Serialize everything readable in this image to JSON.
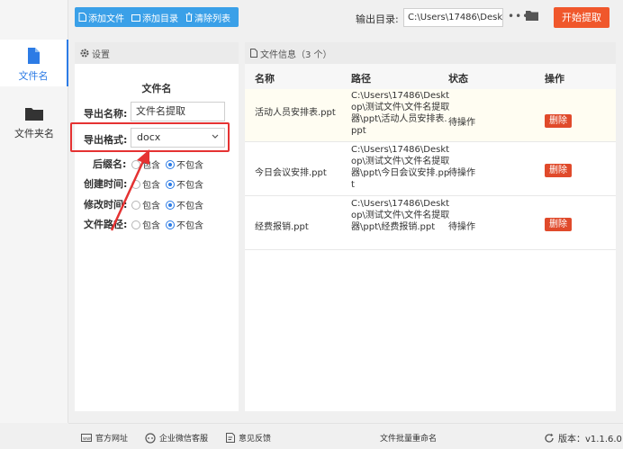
{
  "nav": {
    "items": [
      {
        "label": "文件名",
        "icon": "file-icon",
        "active": true
      },
      {
        "label": "文件夹名",
        "icon": "folder-icon",
        "active": false
      }
    ]
  },
  "toolbar": {
    "add_file": "添加文件",
    "add_dir": "添加目录",
    "clear_list": "清除列表",
    "output_label": "输出目录:",
    "output_path": "C:\\Users\\17486\\Deskto",
    "more": "•••",
    "start": "开始提取"
  },
  "settings": {
    "header": "设置",
    "section_title": "文件名",
    "export_name_label": "导出名称:",
    "export_name_value": "文件名提取",
    "export_format_label": "导出格式:",
    "export_format_value": "docx",
    "options": [
      {
        "label": "后缀名:",
        "include": "包含",
        "exclude": "不包含",
        "selected": "exclude"
      },
      {
        "label": "创建时间:",
        "include": "包含",
        "exclude": "不包含",
        "selected": "exclude"
      },
      {
        "label": "修改时间:",
        "include": "包含",
        "exclude": "不包含",
        "selected": "exclude"
      },
      {
        "label": "文件路径:",
        "include": "包含",
        "exclude": "不包含",
        "selected": "exclude"
      }
    ]
  },
  "files": {
    "header": "文件信息（3 个）",
    "columns": {
      "name": "名称",
      "path": "路径",
      "status": "状态",
      "action": "操作"
    },
    "rows": [
      {
        "name": "活动人员安排表.ppt",
        "path": "C:\\Users\\17486\\Desktop\\测试文件\\文件名提取器\\ppt\\活动人员安排表.ppt",
        "status": "待操作",
        "action": "删除"
      },
      {
        "name": "今日会议安排.ppt",
        "path": "C:\\Users\\17486\\Desktop\\测试文件\\文件名提取器\\ppt\\今日会议安排.ppt",
        "status": "待操作",
        "action": "删除"
      },
      {
        "name": "经费报销.ppt",
        "path": "C:\\Users\\17486\\Desktop\\测试文件\\文件名提取器\\ppt\\经费报销.ppt",
        "status": "待操作",
        "action": "删除"
      }
    ]
  },
  "footer": {
    "website": "官方网址",
    "wechat": "企业微信客服",
    "feedback": "意见反馈",
    "app_name": "文件批量重命名",
    "version": "版本：v1.1.6.0"
  },
  "colors": {
    "accent": "#2c7be5",
    "toolbar": "#3aa0e8",
    "start": "#f0572b",
    "delete": "#e04a2b",
    "highlight": "#e53232"
  }
}
